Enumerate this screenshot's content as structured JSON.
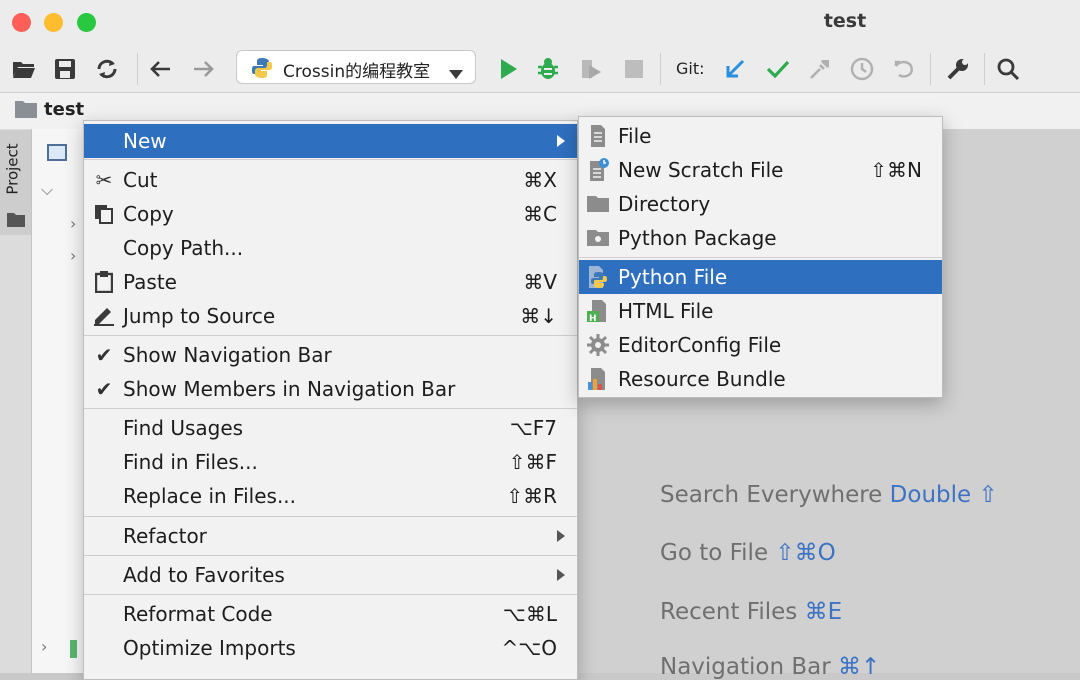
{
  "window": {
    "title": "test"
  },
  "toolbar": {
    "run_config": "Crossin的编程教室",
    "git_label": "Git:"
  },
  "navbar": {
    "project_name": "test"
  },
  "side": {
    "project_tab": "Project"
  },
  "context_menu": {
    "items": [
      {
        "label": "New",
        "shortcut": "",
        "icon": "none",
        "submenu": true,
        "selected": true
      },
      {
        "label": "Cut",
        "shortcut": "⌘X",
        "icon": "scissors-icon"
      },
      {
        "label": "Copy",
        "shortcut": "⌘C",
        "icon": "copy-icon"
      },
      {
        "label": "Copy Path...",
        "shortcut": "",
        "icon": "none"
      },
      {
        "label": "Paste",
        "shortcut": "⌘V",
        "icon": "clipboard-icon"
      },
      {
        "label": "Jump to Source",
        "shortcut": "⌘↓",
        "icon": "pencil-icon"
      },
      {
        "label": "Show Navigation Bar",
        "shortcut": "",
        "icon": "check-icon"
      },
      {
        "label": "Show Members in Navigation Bar",
        "shortcut": "",
        "icon": "check-icon"
      },
      {
        "label": "Find Usages",
        "shortcut": "⌥F7",
        "icon": "none"
      },
      {
        "label": "Find in Files...",
        "shortcut": "⇧⌘F",
        "icon": "none"
      },
      {
        "label": "Replace in Files...",
        "shortcut": "⇧⌘R",
        "icon": "none"
      },
      {
        "label": "Refactor",
        "shortcut": "",
        "icon": "none",
        "submenu": true
      },
      {
        "label": "Add to Favorites",
        "shortcut": "",
        "icon": "none",
        "submenu": true
      },
      {
        "label": "Reformat Code",
        "shortcut": "⌥⌘L",
        "icon": "none"
      },
      {
        "label": "Optimize Imports",
        "shortcut": "^⌥O",
        "icon": "none"
      }
    ]
  },
  "new_submenu": {
    "items": [
      {
        "label": "File",
        "shortcut": "",
        "icon": "file-icon"
      },
      {
        "label": "New Scratch File",
        "shortcut": "⇧⌘N",
        "icon": "scratch-file-icon"
      },
      {
        "label": "Directory",
        "shortcut": "",
        "icon": "folder-icon"
      },
      {
        "label": "Python Package",
        "shortcut": "",
        "icon": "package-folder-icon"
      },
      {
        "label": "Python File",
        "shortcut": "",
        "icon": "python-file-icon",
        "selected": true
      },
      {
        "label": "HTML File",
        "shortcut": "",
        "icon": "html-file-icon"
      },
      {
        "label": "EditorConfig File",
        "shortcut": "",
        "icon": "gear-icon"
      },
      {
        "label": "Resource Bundle",
        "shortcut": "",
        "icon": "resource-bundle-icon"
      }
    ]
  },
  "editor_hints": {
    "search_label": "Search Everywhere",
    "search_key": "Double ⇧",
    "goto_label": "Go to File",
    "goto_key": "⇧⌘O",
    "recent_label": "Recent Files",
    "recent_key": "⌘E",
    "nav_label": "Navigation Bar",
    "nav_key": "⌘↑"
  },
  "colors": {
    "selection": "#2f6fbf",
    "hint_key": "#3d73c4",
    "run_green": "#2eaa4f",
    "git_blue": "#2a8fdc"
  }
}
